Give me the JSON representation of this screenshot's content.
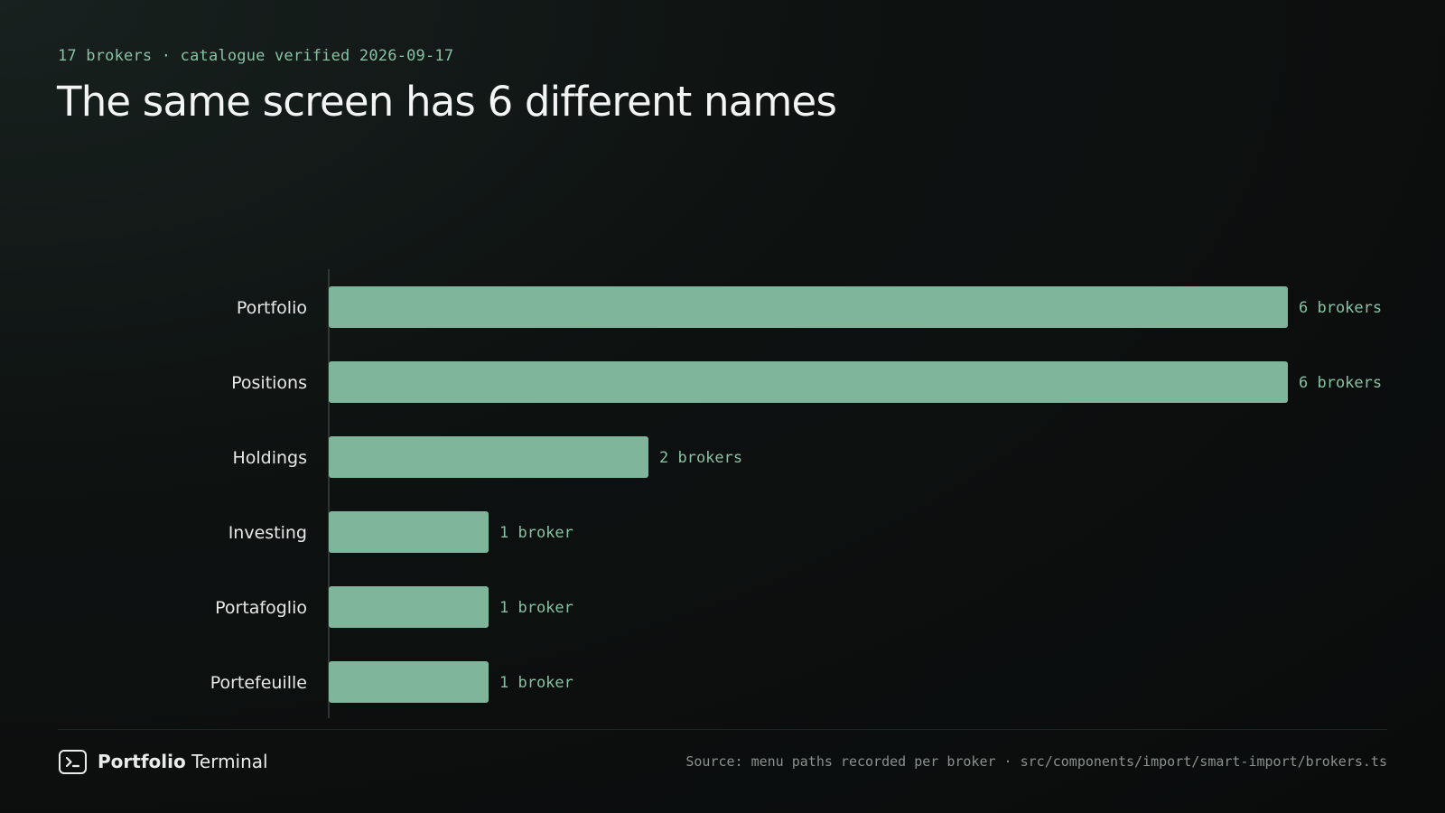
{
  "header": {
    "kicker": "17 brokers · catalogue verified 2026-09-17",
    "title": "The same screen has 6 different names"
  },
  "chart_data": {
    "type": "bar",
    "orientation": "horizontal",
    "categories": [
      "Portfolio",
      "Positions",
      "Holdings",
      "Investing",
      "Portafoglio",
      "Portefeuille"
    ],
    "values": [
      6,
      6,
      2,
      1,
      1,
      1
    ],
    "value_labels": [
      "6 brokers",
      "6 brokers",
      "2 brokers",
      "1 broker",
      "1 broker",
      "1 broker"
    ],
    "xlim": [
      0,
      6
    ],
    "grid": false,
    "legend": "none",
    "bar_color": "#7fb59a",
    "label_color": "#86c2a3"
  },
  "footer": {
    "brand_strong": "Portfolio",
    "brand_rest": "Terminal",
    "brand_icon": "terminal-prompt-icon",
    "source": "Source: menu paths recorded per broker · src/components/import/smart-import/brokers.ts"
  }
}
